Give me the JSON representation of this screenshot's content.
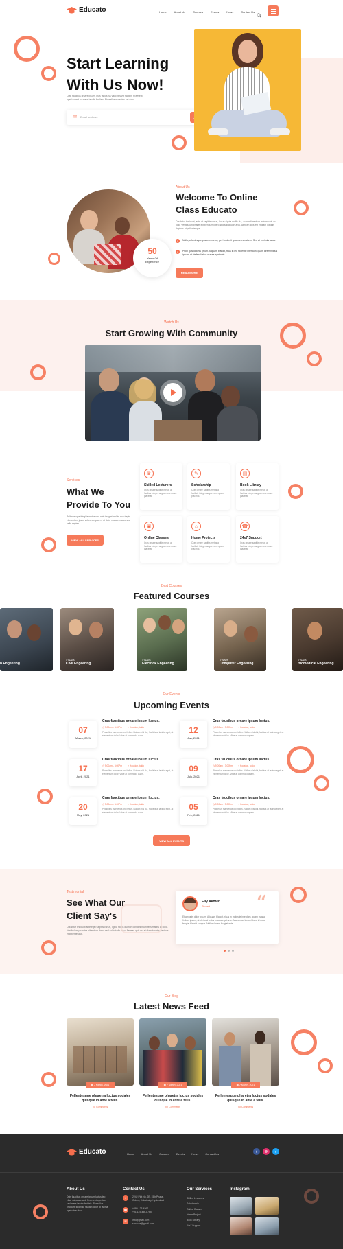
{
  "brand": {
    "name": "Educato",
    "accent": "#f66e4d"
  },
  "nav": {
    "items": [
      "Home",
      "About Us",
      "Courses",
      "Events",
      "News",
      "Contact Us"
    ]
  },
  "hero": {
    "title_line1": "Start Learning",
    "title_line2": "With Us Now!",
    "text_line1": "Cras faucibus ornare ipsum. Inas faclus iss vaucibus vel sapien. Praesent",
    "text_line2": "eget laoreet eu mass iaculis facilisis. Phasellus molestus est dolor.",
    "email_placeholder": "Email address",
    "cta": "Learn More Now"
  },
  "about": {
    "kicker": "About Us",
    "title_line1": "Welcome To Online",
    "title_line2": "Class Educato",
    "text": "Curabitur tincidunt, ante at sagittis varius, leo eu ligula mollis dui, ac condimentum felis mauris ac odio. Vestibulum pharetra bibendum libero sed sollicitudin arcu. Aenean quis est et diam lobortis dapibus et pellentesque.",
    "bullet1": "Nulla pellentesque posuere metus, pel hendrerit ipsum venenatis in. Sed at vehicula lacus.",
    "bullet2": "Proin quis lobortis ipsum. Aliquam blandit, risus in leo molestie interdum, quam lorem finibus ipsum, at eleifend tellus massa eget ante.",
    "badge_number": "50",
    "badge_line1": "Years Of",
    "badge_line2": "Experience",
    "cta": "Read More"
  },
  "community": {
    "kicker": "Watch Us",
    "title": "Start Growing With Community"
  },
  "services": {
    "kicker": "Services",
    "title_line1": "What We",
    "title_line2": "Provide To You",
    "text": "Pellentesque fringilla metus sed ante feugiat mollis, non turpis elementum justo, vel consequat mi ut dolor massa maecenas pelle sapien.",
    "cta": "View All Services",
    "items": [
      {
        "icon": "lecturer-icon",
        "glyph": "♛",
        "title": "Skilled Lecturers",
        "text": "Cras ornare sagittis metus a facilisis integer augue nunc quam placerat."
      },
      {
        "icon": "scholarship-icon",
        "glyph": "✎",
        "title": "Scholarship",
        "text": "Cras ornare sagittis metus a facilisis integer augue nunc quam placerat."
      },
      {
        "icon": "library-icon",
        "glyph": "▤",
        "title": "Book Library",
        "text": "Cras ornare sagittis metus a facilisis integer augue nunc quam placerat."
      },
      {
        "icon": "online-classes-icon",
        "glyph": "▣",
        "title": "Online Classes",
        "text": "Cras ornare sagittis metus a facilisis integer augue nunc quam placerat."
      },
      {
        "icon": "home-projects-icon",
        "glyph": "⌂",
        "title": "Home Projects",
        "text": "Cras ornare sagittis metus a facilisis integer augue nunc quam placerat."
      },
      {
        "icon": "support-icon",
        "glyph": "☎",
        "title": "24x7 Support",
        "text": "Cras ornare sagittis metus a facilisis integer augue nunc quam placerat."
      }
    ]
  },
  "courses": {
    "kicker": "Best Courses",
    "title": "Featured Courses",
    "items": [
      {
        "years": "",
        "name": "n Engeering"
      },
      {
        "years": "4 YEARS",
        "name": "Civil Engeering"
      },
      {
        "years": "4 YEARS",
        "name": "Electrick Engeering"
      },
      {
        "years": "4 YEARS",
        "name": "Computer Engeering"
      },
      {
        "years": "4 YEARS",
        "name": "Biomedical Engeering"
      }
    ]
  },
  "events": {
    "kicker": "Our Events",
    "title": "Upcoming Events",
    "cta": "View All Events",
    "items": [
      {
        "day": "07",
        "month": "March, 2021",
        "title": "Cras faucibus ornare ipsum luctus.",
        "time": "9:00am - 3:00Pm",
        "place": "Houston, tokio",
        "text": "Phasellus maecenas orci tellus. Nullam nisl dui, facilisis at lacinia eget, at elementum dolor. Vitae at commodo quam."
      },
      {
        "day": "12",
        "month": "Jan, 2021",
        "title": "Cras faucibus ornare ipsum luctus.",
        "time": "9:00am - 3:00Pm",
        "place": "Houston, tokio",
        "text": "Phasellus maecenas orci tellus. Nullam nisl dui, facilisis at lacinia eget, at elementum dolor. Vitae at commodo quam."
      },
      {
        "day": "17",
        "month": "April, 2021",
        "title": "Cras faucibus ornare ipsum luctus.",
        "time": "9:00am - 3:00Pm",
        "place": "Houston, tokio",
        "text": "Phasellus maecenas orci tellus. Nullam nisl dui, facilisis at lacinia eget, at elementum dolor. Vitae at commodo quam."
      },
      {
        "day": "09",
        "month": "July, 2021",
        "title": "Cras faucibus ornare ipsum luctus.",
        "time": "9:00am - 3:00Pm",
        "place": "Houston, tokio",
        "text": "Phasellus maecenas orci tellus. Nullam nisl dui, facilisis at lacinia eget, at elementum dolor. Vitae at commodo quam."
      },
      {
        "day": "20",
        "month": "May, 2021",
        "title": "Cras faucibus ornare ipsum luctus.",
        "time": "9:00am - 3:00Pm",
        "place": "Houston, tokio",
        "text": "Phasellus maecenas orci tellus. Nullam nisl dui, facilisis at lacinia eget, at elementum dolor. Vitae at commodo quam."
      },
      {
        "day": "05",
        "month": "Feb, 2021",
        "title": "Cras faucibus ornare ipsum luctus.",
        "time": "9:00am - 3:00Pm",
        "place": "Houston, tokio",
        "text": "Phasellus maecenas orci tellus. Nullam nisl dui, facilisis at lacinia eget, at elementum dolor. Vitae at commodo quam."
      }
    ]
  },
  "testimonial": {
    "kicker": "Testimonial",
    "title_line1": "See What Our",
    "title_line2": "Client Say's",
    "text": "Curabitur tincidunt ante eget sagittis varius, ligula mollis dui non condimentum felis mauris ac odio. Vestibulum pharetra bibendum libero sed sollicitudin arcu. Aenean quis est et diam lobortis dapibus et pellentesque.",
    "name": "Elly Akhter",
    "role": "Student",
    "quote": "Etiam quis dolor ipsum. Aliquam blandit, risus in molestie interdum, quam massa finibus ipsum, at eleifend tellus massa eget ante. Maecenas luctus libero id dolor feugiat blandit congue. Nullam lorem feugiat ante."
  },
  "blog": {
    "kicker": "Our Blog",
    "title": "Latest News Feed",
    "items": [
      {
        "date": "7 March, 2021",
        "title_line1": "Pellentesque pharetra luctus sodales",
        "title_line2": "quisque in ante a felis.",
        "meta": "(0) Comments"
      },
      {
        "date": "7 March, 2021",
        "title_line1": "Pellentesque pharetra luctus sodales",
        "title_line2": "quisque in ante a felis.",
        "meta": "(0) Comments"
      },
      {
        "date": "7 March, 2021",
        "title_line1": "Pellentesque pharetra luctus sodales",
        "title_line2": "quisque in ante a felis.",
        "meta": "(0) Comments"
      }
    ]
  },
  "footer": {
    "nav": [
      "Home",
      "About Us",
      "Courses",
      "Events",
      "News",
      "Contact Us"
    ],
    "about_title": "About Us",
    "about_text": "Duis faucibus ornare ipsum luctus leo vitae vulputate sed. Praesent egestas sed mass iaculis facilisis. Phasellus tincidunt sed nisl. Nullam dolor at lacinia eget vitae dolor.",
    "contact_title": "Contact Us",
    "address_line1": "2242 Plot No. 2B, 15th Phase,",
    "address_line2": "Colony, Kukatpally, Hyderabad",
    "phone_line1": "+880-123-4567",
    "phone_line2": "+91 123-456-8765",
    "email_line1": "info@gmail.com",
    "email_line2": "services@gmail.com",
    "services_title": "Our Services",
    "services": [
      "Skilled Lecturers",
      "Scholarship",
      "Online Classes",
      "Home Project",
      "Book Library",
      "24x7 Support"
    ],
    "instagram_title": "Instagram"
  }
}
